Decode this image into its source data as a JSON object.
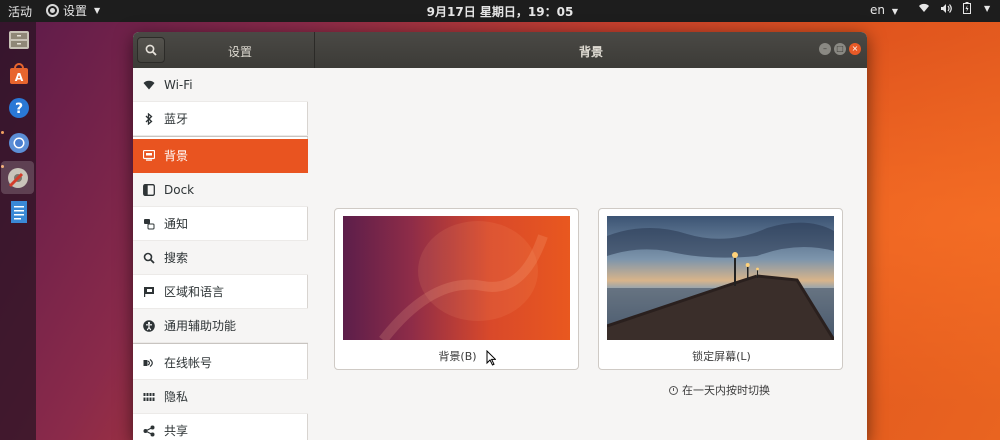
{
  "topbar": {
    "activities": "活动",
    "app_name": "设置",
    "clock": "9月17日 星期日，19：05",
    "lang": "en"
  },
  "window": {
    "sidebar_title": "设置",
    "title": "背景"
  },
  "sidebar": {
    "items": [
      {
        "label": "Wi-Fi",
        "icon": "wifi-icon"
      },
      {
        "label": "蓝牙",
        "icon": "bluetooth-icon"
      },
      {
        "label": "背景",
        "icon": "background-icon",
        "selected": true
      },
      {
        "label": "Dock",
        "icon": "dock-icon"
      },
      {
        "label": "通知",
        "icon": "notification-icon"
      },
      {
        "label": "搜索",
        "icon": "search-icon"
      },
      {
        "label": "区域和语言",
        "icon": "region-flag-icon"
      },
      {
        "label": "通用辅助功能",
        "icon": "accessibility-icon"
      },
      {
        "label": "在线帐号",
        "icon": "online-accounts-icon"
      },
      {
        "label": "隐私",
        "icon": "privacy-icon"
      },
      {
        "label": "共享",
        "icon": "share-icon"
      }
    ]
  },
  "content": {
    "background_label": "背景(B)",
    "lockscreen_label": "锁定屏幕(L)",
    "note": "在一天内按时切换"
  },
  "colors": {
    "accent": "#e95420",
    "headerbar": "#3c3b37",
    "topbar": "#1d1d1d"
  }
}
